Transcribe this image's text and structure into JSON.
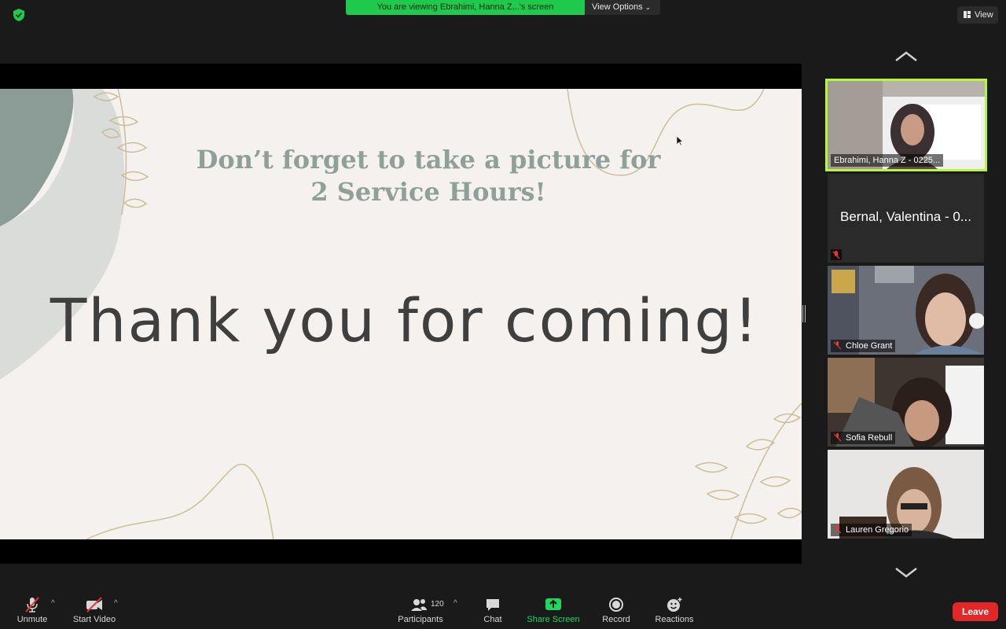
{
  "top_bar": {
    "banner_text": "You are viewing Ebrahimi, Hanna Z...'s screen",
    "view_options_label": "View Options",
    "view_label": "View"
  },
  "slide": {
    "subtitle_line1": "Don’t forget to take a picture for",
    "subtitle_line2": "2 Service Hours!",
    "main_text": "Thank you for coming!"
  },
  "participants": [
    {
      "name": "Ebrahimi, Hanna Z - 0225...",
      "active": true,
      "video": true
    },
    {
      "name": "Bernal, Valentina - 0...",
      "video": false
    },
    {
      "name": "Chloe Grant",
      "video": true
    },
    {
      "name": "Sofia Rebull",
      "video": true
    },
    {
      "name": "Lauren Gregorio",
      "video": true
    }
  ],
  "toolbar": {
    "unmute_label": "Unmute",
    "start_video_label": "Start Video",
    "participants_label": "Participants",
    "participants_count": "120",
    "chat_label": "Chat",
    "share_screen_label": "Share Screen",
    "record_label": "Record",
    "reactions_label": "Reactions",
    "leave_label": "Leave"
  },
  "colors": {
    "banner_green": "#1ec94c",
    "active_border": "#b6f542",
    "leave_red": "#e02828",
    "share_green": "#1ed760"
  }
}
